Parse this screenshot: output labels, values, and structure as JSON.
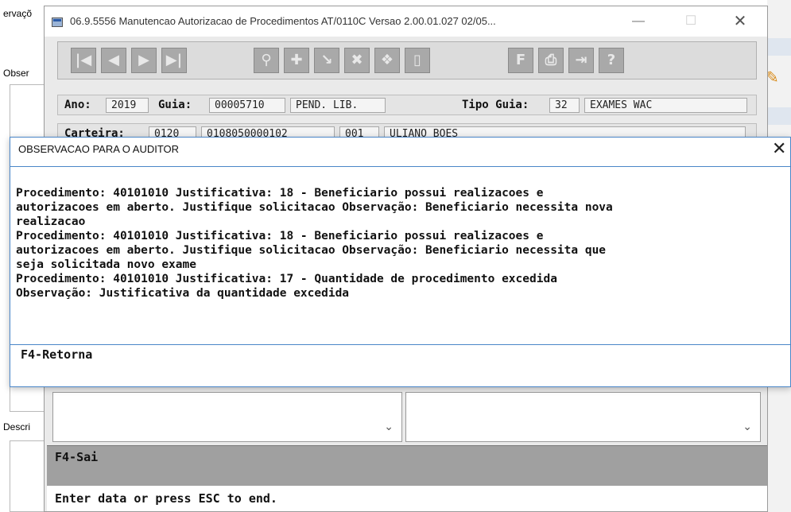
{
  "background": {
    "label_top": "ervaçõ",
    "label_obs": "Obser",
    "label_desc": "Descri"
  },
  "main_window": {
    "title": "06.9.5556 Manutencao Autorizacao de Procedimentos AT/0110C Versao 2.00.01.027 02/05...",
    "window_buttons": {
      "minimize": "—",
      "maximize": "☐",
      "close": "✕"
    },
    "toolbar_icons": [
      "first-record-icon",
      "prev-record-icon",
      "next-record-icon",
      "last-record-icon",
      "search-icon",
      "add-icon",
      "edit-icon",
      "delete-icon",
      "copy-icon",
      "exit-door-icon",
      "filter-icon",
      "print-icon",
      "export-icon",
      "help-icon"
    ],
    "toolbar_glyphs": [
      "|◀",
      "◀",
      "▶",
      "▶|",
      "⚲",
      "✚",
      "↘",
      "✖",
      "❖",
      "▯",
      "F",
      "⎙",
      "⇥",
      "?"
    ],
    "row1": {
      "ano_label": "Ano:",
      "ano_value": "2019",
      "guia_label": "Guia:",
      "guia_value": "00005710",
      "status_value": "PEND. LIB.",
      "tipo_label": "Tipo Guia:",
      "tipo_code": "32",
      "tipo_desc": "EXAMES WAC"
    },
    "row2": {
      "carteira_label": "Carteira:",
      "c1": "0120",
      "c2": "0108050000102",
      "c3": "001",
      "nome": "ULIANO BOES"
    },
    "sai_hint": "F4-Sai",
    "status_text": "Enter data or press ESC to end."
  },
  "dialog": {
    "title": "OBSERVACAO PARA O AUDITOR",
    "close": "✕",
    "lines": [
      "Procedimento: 40101010 Justificativa: 18 - Beneficiario possui realizacoes e",
      "autorizacoes em aberto. Justifique solicitacao Observação: Beneficiario necessita nova",
      "realizacao",
      "Procedimento: 40101010 Justificativa: 18 - Beneficiario possui realizacoes e",
      "autorizacoes em aberto. Justifique solicitacao Observação: Beneficiario necessita que",
      "seja solicitada novo exame",
      "Procedimento: 40101010 Justificativa: 17 - Quantidade de procedimento excedida",
      "Observação: Justificativa da quantidade excedida"
    ],
    "footer_hint": "F4-Retorna"
  }
}
